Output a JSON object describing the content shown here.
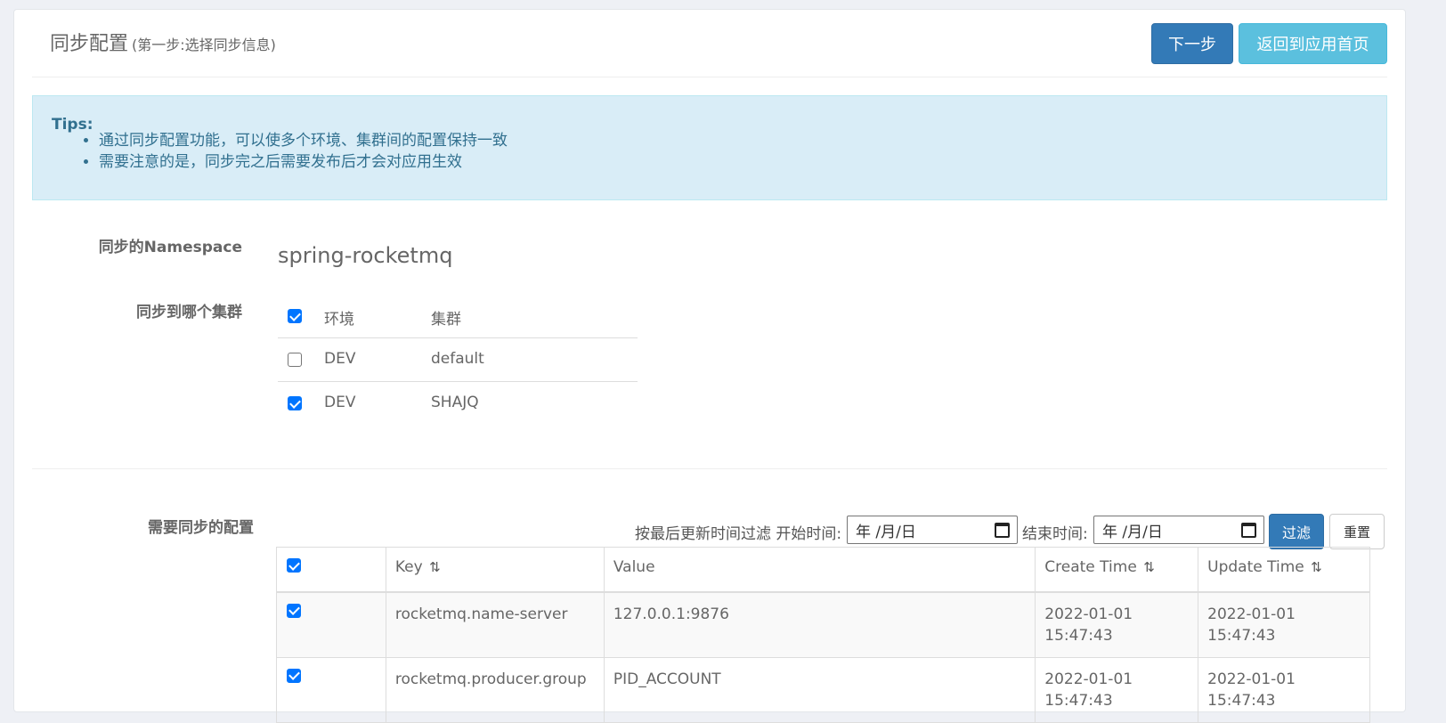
{
  "header": {
    "title": "同步配置",
    "subtitle": "(第一步:选择同步信息)",
    "next_label": "下一步",
    "home_label": "返回到应用首页"
  },
  "tips": {
    "title": "Tips:",
    "items": [
      "通过同步配置功能，可以使多个环境、集群间的配置保持一致",
      "需要注意的是，同步完之后需要发布后才会对应用生效"
    ]
  },
  "namespace": {
    "label": "同步的Namespace",
    "value": "spring-rocketmq"
  },
  "clusters": {
    "label": "同步到哪个集群",
    "header": {
      "checked": true,
      "env": "环境",
      "cluster": "集群"
    },
    "rows": [
      {
        "checked": false,
        "env": "DEV",
        "cluster": "default"
      },
      {
        "checked": true,
        "env": "DEV",
        "cluster": "SHAJQ"
      }
    ]
  },
  "configs": {
    "label": "需要同步的配置",
    "filter_label": "按最后更新时间过滤 开始时间:",
    "end_label": "结束时间:",
    "start_placeholder": "年 /月/日",
    "end_placeholder": "年 /月/日",
    "filter_button": "过滤",
    "reset_button": "重置",
    "columns": {
      "key": "Key",
      "value": "Value",
      "create": "Create Time",
      "update": "Update Time"
    },
    "header_checked": true,
    "rows": [
      {
        "checked": true,
        "key": "rocketmq.name-server",
        "value": "127.0.0.1:9876",
        "create": "2022-01-01 15:47:43",
        "update": "2022-01-01 15:47:43"
      },
      {
        "checked": true,
        "key": "rocketmq.producer.group",
        "value": "PID_ACCOUNT",
        "create": "2022-01-01 15:47:43",
        "update": "2022-01-01 15:47:43"
      }
    ]
  }
}
